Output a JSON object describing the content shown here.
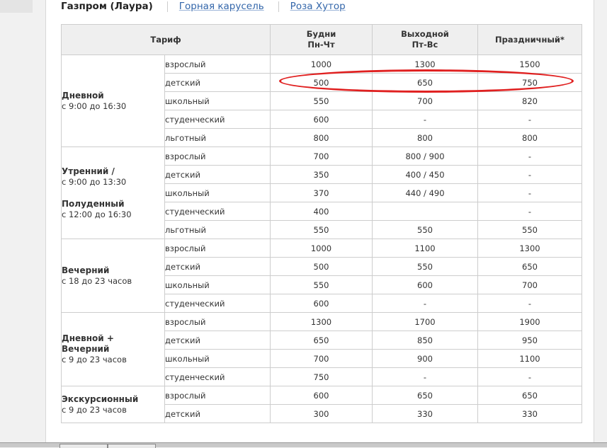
{
  "tabs": {
    "active": "Газпром (Лаура)",
    "links": [
      "Горная карусель",
      "Роза Хутор"
    ]
  },
  "table": {
    "headers": {
      "tariff": "Тариф",
      "weekdays": [
        "Будни",
        "Пн-Чт"
      ],
      "weekend": [
        "Выходной",
        "Пт-Вс"
      ],
      "holiday": "Праздничный*"
    },
    "groups": [
      {
        "name": "Дневной",
        "time": "с 9:00 до 16:30",
        "rows": [
          {
            "category": "взрослый",
            "weekdays": "1000",
            "weekend": "1300",
            "holiday": "1500"
          },
          {
            "category": "детский",
            "weekdays": "500",
            "weekend": "650",
            "holiday": "750"
          },
          {
            "category": "школьный",
            "weekdays": "550",
            "weekend": "700",
            "holiday": "820"
          },
          {
            "category": "студенческий",
            "weekdays": "600",
            "weekend": "-",
            "holiday": "-"
          },
          {
            "category": "льготный",
            "weekdays": "800",
            "weekend": "800",
            "holiday": "800"
          }
        ]
      },
      {
        "name": "Утренний /",
        "time": "с 9:00 до 13:30",
        "name2": "Полуденный",
        "time2": "с 12:00 до 16:30",
        "rows": [
          {
            "category": "взрослый",
            "weekdays": "700",
            "weekend": "800 / 900",
            "holiday": "-"
          },
          {
            "category": "детский",
            "weekdays": "350",
            "weekend": "400 / 450",
            "holiday": "-"
          },
          {
            "category": "школьный",
            "weekdays": "370",
            "weekend": "440 / 490",
            "holiday": "-"
          },
          {
            "category": "студенческий",
            "weekdays": "400",
            "weekend": "",
            "holiday": "-"
          },
          {
            "category": "льготный",
            "weekdays": "550",
            "weekend": "550",
            "holiday": "550"
          }
        ]
      },
      {
        "name": "Вечерний",
        "time": "с 18 до 23 часов",
        "rows": [
          {
            "category": "взрослый",
            "weekdays": "1000",
            "weekend": "1100",
            "holiday": "1300"
          },
          {
            "category": "детский",
            "weekdays": "500",
            "weekend": "550",
            "holiday": "650"
          },
          {
            "category": "школьный",
            "weekdays": "550",
            "weekend": "600",
            "holiday": "700"
          },
          {
            "category": "студенческий",
            "weekdays": "600",
            "weekend": "-",
            "holiday": "-"
          }
        ]
      },
      {
        "name": "Дневной + Вечерний",
        "time": "с 9 до 23 часов",
        "rows": [
          {
            "category": "взрослый",
            "weekdays": "1300",
            "weekend": "1700",
            "holiday": "1900"
          },
          {
            "category": "детский",
            "weekdays": "650",
            "weekend": "850",
            "holiday": "950"
          },
          {
            "category": "школьный",
            "weekdays": "700",
            "weekend": "900",
            "holiday": "1100"
          },
          {
            "category": "студенческий",
            "weekdays": "750",
            "weekend": "-",
            "holiday": "-"
          }
        ]
      },
      {
        "name": "Экскурсионный",
        "time": "с 9 до 23 часов",
        "rows": [
          {
            "category": "взрослый",
            "weekdays": "600",
            "weekend": "650",
            "holiday": "650"
          },
          {
            "category": "детский",
            "weekdays": "300",
            "weekend": "330",
            "holiday": "330"
          }
        ]
      }
    ]
  },
  "colors": {
    "highlight_ellipse": "#e02020",
    "link": "#3366aa",
    "header_bg": "#efefef",
    "border": "#cdcdcd"
  }
}
